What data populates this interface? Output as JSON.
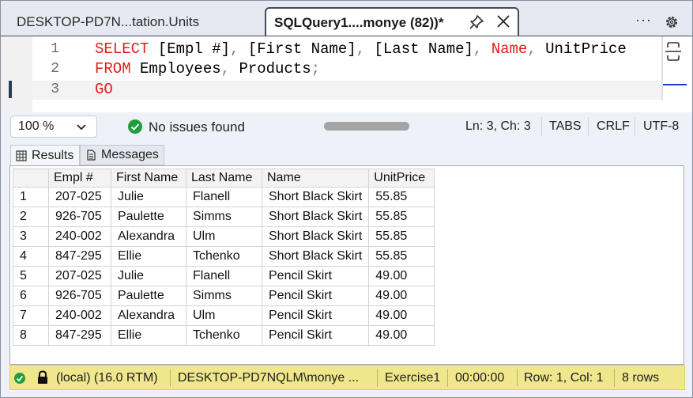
{
  "tabs": [
    {
      "label": "DESKTOP-PD7N...tation.Units",
      "active": false
    },
    {
      "label": "SQLQuery1....monye (82))*",
      "active": true
    }
  ],
  "tab_menu": {
    "more": "···"
  },
  "editor": {
    "line_numbers": [
      "1",
      "2",
      "3"
    ],
    "lines": [
      [
        [
          "kw",
          "SELECT"
        ],
        [
          "tx",
          " [Empl #]"
        ],
        [
          "pn",
          ","
        ],
        [
          "tx",
          " [First Name]"
        ],
        [
          "pn",
          ","
        ],
        [
          "tx",
          " [Last Name]"
        ],
        [
          "pn",
          ","
        ],
        [
          "kw",
          " Name"
        ],
        [
          "pn",
          ","
        ],
        [
          "tx",
          " UnitPrice"
        ]
      ],
      [
        [
          "kw",
          "FROM"
        ],
        [
          "tx",
          " Employees"
        ],
        [
          "pn",
          ","
        ],
        [
          "tx",
          " Products"
        ],
        [
          "pn",
          ";"
        ]
      ],
      [
        [
          "kw",
          "GO"
        ]
      ]
    ]
  },
  "status_strip": {
    "zoom": "100 %",
    "issues": "No issues found",
    "position": "Ln: 3, Ch: 3",
    "indent": "TABS",
    "line_ending": "CRLF",
    "encoding": "UTF-8"
  },
  "results_tabs": [
    "Results",
    "Messages"
  ],
  "grid": {
    "columns": [
      "",
      "Empl #",
      "First Name",
      "Last Name",
      "Name",
      "UnitPrice"
    ],
    "rows": [
      [
        "1",
        "207-025",
        "Julie",
        "Flanell",
        "Short Black Skirt",
        "55.85"
      ],
      [
        "2",
        "926-705",
        "Paulette",
        "Simms",
        "Short Black Skirt",
        "55.85"
      ],
      [
        "3",
        "240-002",
        "Alexandra",
        "Ulm",
        "Short Black Skirt",
        "55.85"
      ],
      [
        "4",
        "847-295",
        "Ellie",
        "Tchenko",
        "Short Black Skirt",
        "55.85"
      ],
      [
        "5",
        "207-025",
        "Julie",
        "Flanell",
        "Pencil Skirt",
        "49.00"
      ],
      [
        "6",
        "926-705",
        "Paulette",
        "Simms",
        "Pencil Skirt",
        "49.00"
      ],
      [
        "7",
        "240-002",
        "Alexandra",
        "Ulm",
        "Pencil Skirt",
        "49.00"
      ],
      [
        "8",
        "847-295",
        "Ellie",
        "Tchenko",
        "Pencil Skirt",
        "49.00"
      ]
    ]
  },
  "bottom_status": {
    "server": "(local) (16.0 RTM)",
    "user": "DESKTOP-PD7NQLM\\monye ...",
    "database": "Exercise1",
    "elapsed": "00:00:00",
    "cursor": "Row: 1, Col: 1",
    "row_count": "8 rows"
  },
  "colors": {
    "keyword": "#e41d1d",
    "status_bar": "#f0e68c",
    "ok_green": "#1e9e3e",
    "accent_blue": "#1c3bd4"
  }
}
